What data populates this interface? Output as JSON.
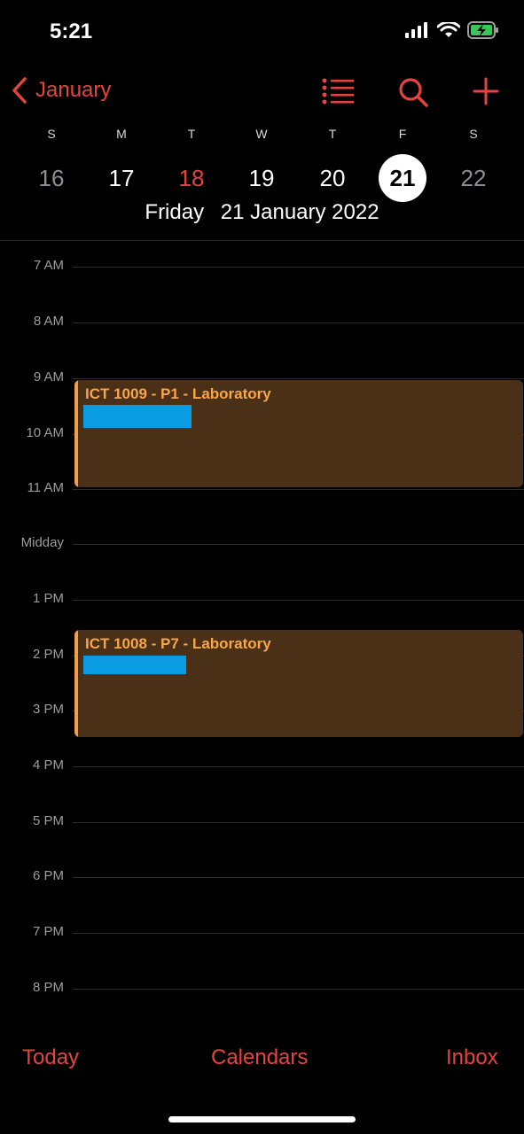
{
  "status_bar": {
    "time": "5:21"
  },
  "nav": {
    "back_label": "January",
    "accent_color": "#e5443e"
  },
  "week": {
    "days": [
      {
        "letter": "S",
        "number": "16"
      },
      {
        "letter": "M",
        "number": "17"
      },
      {
        "letter": "T",
        "number": "18"
      },
      {
        "letter": "W",
        "number": "19"
      },
      {
        "letter": "T",
        "number": "20"
      },
      {
        "letter": "F",
        "number": "21"
      },
      {
        "letter": "S",
        "number": "22"
      }
    ],
    "selected_weekday": "Friday",
    "selected_date": "21 January 2022"
  },
  "timeline": {
    "hours": [
      "7 AM",
      "8 AM",
      "9 AM",
      "10 AM",
      "11 AM",
      "Midday",
      "1 PM",
      "2 PM",
      "3 PM",
      "4 PM",
      "5 PM",
      "6 PM",
      "7 PM",
      "8 PM"
    ]
  },
  "events": [
    {
      "title": "ICT 1009 - P1 - Laboratory",
      "color": "#f7a64b",
      "tag_color": "#0a9ce3"
    },
    {
      "title": "ICT 1008 - P7 - Laboratory",
      "color": "#f7a64b",
      "tag_color": "#0a9ce3"
    }
  ],
  "tabbar": {
    "today": "Today",
    "calendars": "Calendars",
    "inbox": "Inbox"
  }
}
